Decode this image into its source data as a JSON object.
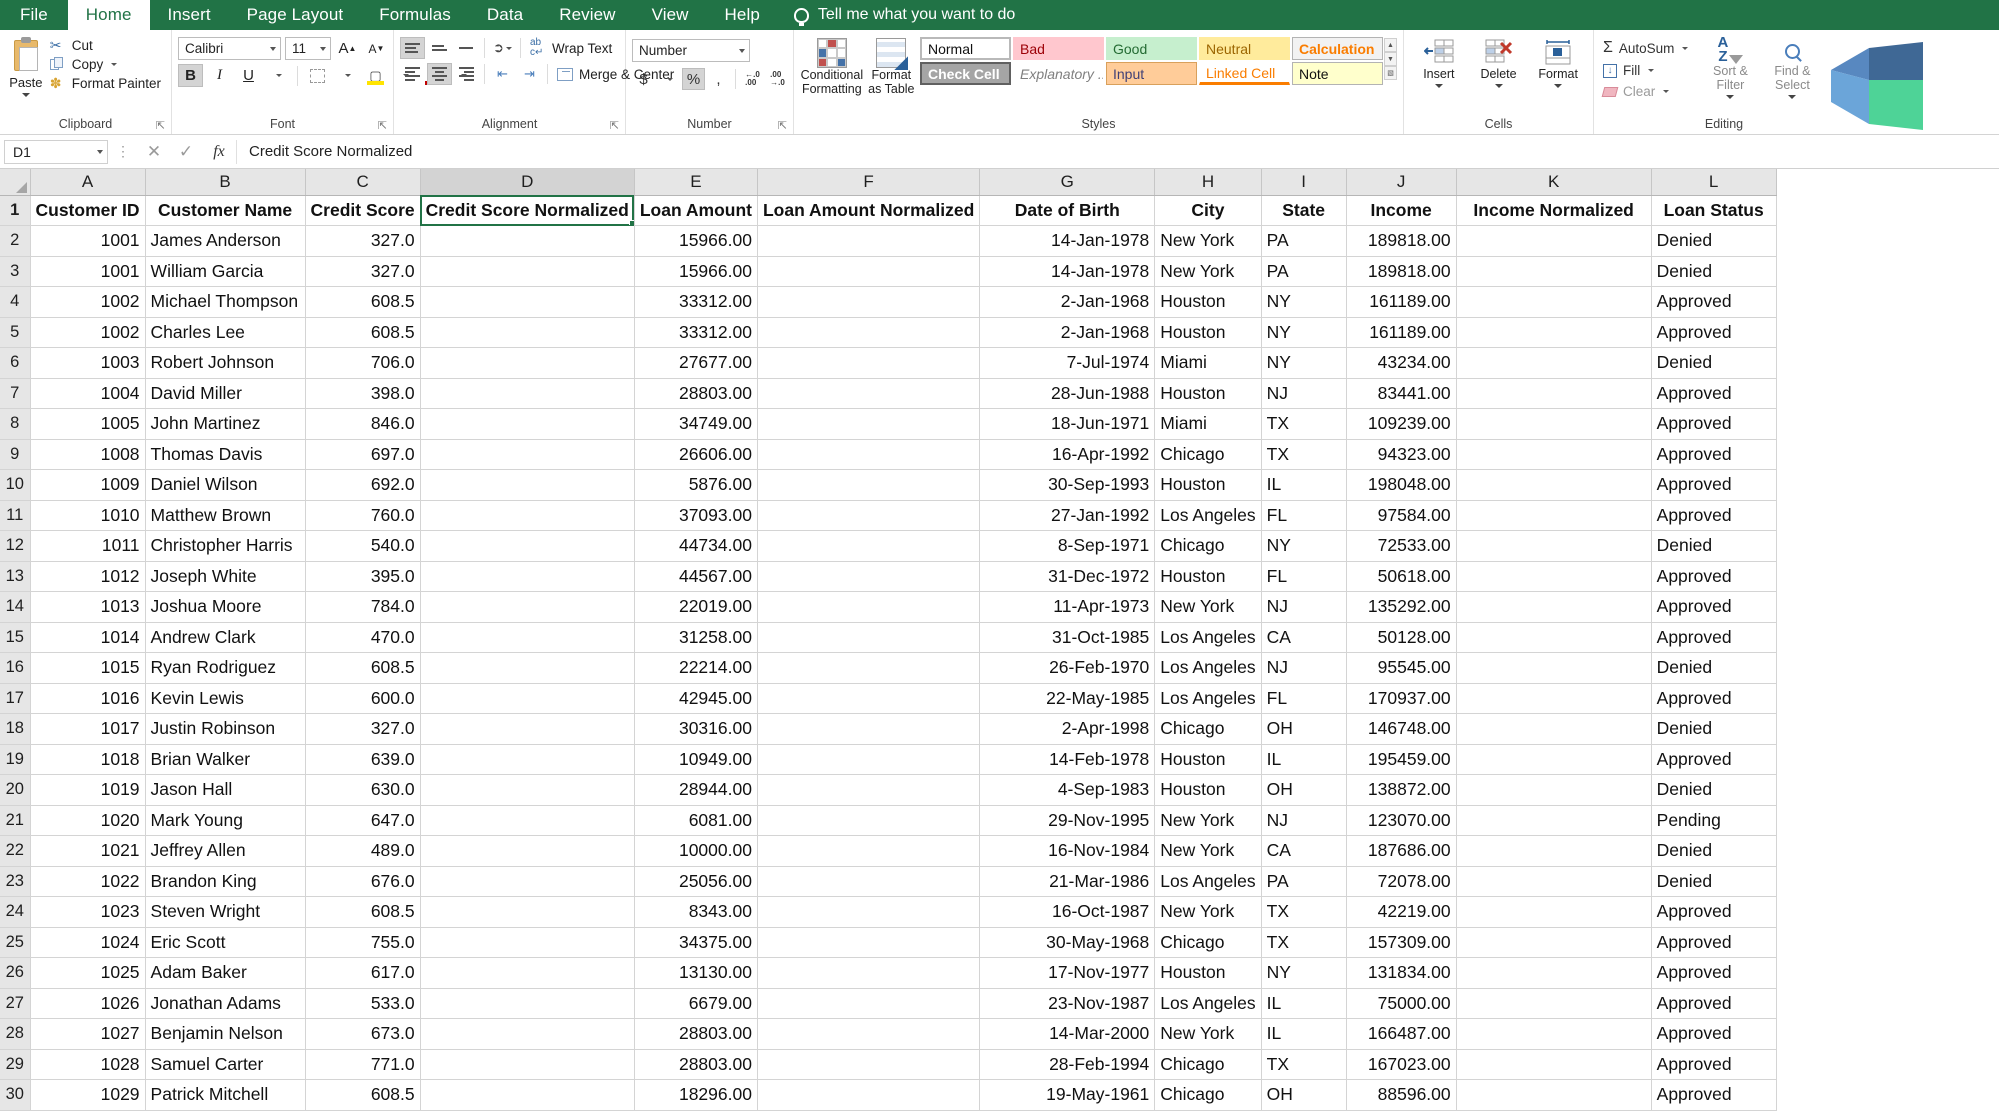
{
  "ribbon": {
    "tabs": [
      {
        "label": "File",
        "active": false
      },
      {
        "label": "Home",
        "active": true
      },
      {
        "label": "Insert",
        "active": false
      },
      {
        "label": "Page Layout",
        "active": false
      },
      {
        "label": "Formulas",
        "active": false
      },
      {
        "label": "Data",
        "active": false
      },
      {
        "label": "Review",
        "active": false
      },
      {
        "label": "View",
        "active": false
      },
      {
        "label": "Help",
        "active": false
      }
    ],
    "tellme": "Tell me what you want to do",
    "clipboard": {
      "group_label": "Clipboard",
      "paste_label": "Paste",
      "cut_label": "Cut",
      "copy_label": "Copy",
      "format_painter_label": "Format Painter"
    },
    "font": {
      "group_label": "Font",
      "font_name": "Calibri",
      "font_size": "11",
      "bold_label": "B",
      "italic_label": "I",
      "underline_label": "U",
      "grow_label": "A",
      "shrink_label": "A"
    },
    "alignment": {
      "group_label": "Alignment",
      "wrap_text_label": "Wrap Text",
      "merge_center_label": "Merge & Center"
    },
    "number": {
      "group_label": "Number",
      "format": "Number",
      "currency_label": "$",
      "percent_label": "%",
      "comma_label": ",",
      "decrease_decimal_label": ".00",
      "increase_decimal_label": ".00"
    },
    "styles": {
      "group_label": "Styles",
      "conditional_formatting_label": "Conditional Formatting",
      "format_as_table_label": "Format as Table",
      "gallery": [
        {
          "label": "Normal",
          "cls": "s-normal"
        },
        {
          "label": "Bad",
          "cls": "s-bad"
        },
        {
          "label": "Good",
          "cls": "s-good"
        },
        {
          "label": "Neutral",
          "cls": "s-neutral"
        },
        {
          "label": "Calculation",
          "cls": "s-calc"
        },
        {
          "label": "Check Cell",
          "cls": "s-check"
        },
        {
          "label": "Explanatory ...",
          "cls": "s-expl"
        },
        {
          "label": "Input",
          "cls": "s-input"
        },
        {
          "label": "Linked Cell",
          "cls": "s-linked"
        },
        {
          "label": "Note",
          "cls": "s-note"
        }
      ]
    },
    "cells": {
      "group_label": "Cells",
      "insert_label": "Insert",
      "delete_label": "Delete",
      "format_label": "Format"
    },
    "editing": {
      "group_label": "Editing",
      "autosum_label": "AutoSum",
      "fill_label": "Fill",
      "clear_label": "Clear",
      "sort_filter_label": "Sort & Filter",
      "find_select_label": "Find & Select"
    }
  },
  "formula_bar": {
    "name_box": "D1",
    "cancel_icon": "✕",
    "confirm_icon": "✓",
    "fx_label": "fx",
    "value": "Credit Score Normalized"
  },
  "sheet": {
    "columns": [
      "A",
      "B",
      "C",
      "D",
      "E",
      "F",
      "G",
      "H",
      "I",
      "J",
      "K",
      "L"
    ],
    "selected_column": "D",
    "selected_cell": "D1",
    "headers": [
      "Customer ID",
      "Customer Name",
      "Credit Score",
      "Credit Score Normalized",
      "Loan Amount",
      "Loan Amount Normalized",
      "Date of Birth",
      "City",
      "State",
      "Income",
      "Income Normalized",
      "Loan Status"
    ],
    "rows": [
      {
        "n": "2",
        "a": "1001",
        "b": "James Anderson",
        "c": "327.0",
        "d": "",
        "e": "15966.00",
        "f": "",
        "g": "14-Jan-1978",
        "h": "New York",
        "i": "PA",
        "j": "189818.00",
        "k": "",
        "l": "Denied"
      },
      {
        "n": "3",
        "a": "1001",
        "b": "William Garcia",
        "c": "327.0",
        "d": "",
        "e": "15966.00",
        "f": "",
        "g": "14-Jan-1978",
        "h": "New York",
        "i": "PA",
        "j": "189818.00",
        "k": "",
        "l": "Denied"
      },
      {
        "n": "4",
        "a": "1002",
        "b": "Michael Thompson",
        "c": "608.5",
        "d": "",
        "e": "33312.00",
        "f": "",
        "g": "2-Jan-1968",
        "h": "Houston",
        "i": "NY",
        "j": "161189.00",
        "k": "",
        "l": "Approved"
      },
      {
        "n": "5",
        "a": "1002",
        "b": "Charles Lee",
        "c": "608.5",
        "d": "",
        "e": "33312.00",
        "f": "",
        "g": "2-Jan-1968",
        "h": "Houston",
        "i": "NY",
        "j": "161189.00",
        "k": "",
        "l": "Approved"
      },
      {
        "n": "6",
        "a": "1003",
        "b": "Robert Johnson",
        "c": "706.0",
        "d": "",
        "e": "27677.00",
        "f": "",
        "g": "7-Jul-1974",
        "h": "Miami",
        "i": "NY",
        "j": "43234.00",
        "k": "",
        "l": "Denied"
      },
      {
        "n": "7",
        "a": "1004",
        "b": "David Miller",
        "c": "398.0",
        "d": "",
        "e": "28803.00",
        "f": "",
        "g": "28-Jun-1988",
        "h": "Houston",
        "i": "NJ",
        "j": "83441.00",
        "k": "",
        "l": "Approved"
      },
      {
        "n": "8",
        "a": "1005",
        "b": "John Martinez",
        "c": "846.0",
        "d": "",
        "e": "34749.00",
        "f": "",
        "g": "18-Jun-1971",
        "h": "Miami",
        "i": "TX",
        "j": "109239.00",
        "k": "",
        "l": "Approved"
      },
      {
        "n": "9",
        "a": "1008",
        "b": "Thomas Davis",
        "c": "697.0",
        "d": "",
        "e": "26606.00",
        "f": "",
        "g": "16-Apr-1992",
        "h": "Chicago",
        "i": "TX",
        "j": "94323.00",
        "k": "",
        "l": "Approved"
      },
      {
        "n": "10",
        "a": "1009",
        "b": "Daniel Wilson",
        "c": "692.0",
        "d": "",
        "e": "5876.00",
        "f": "",
        "g": "30-Sep-1993",
        "h": "Houston",
        "i": "IL",
        "j": "198048.00",
        "k": "",
        "l": "Approved"
      },
      {
        "n": "11",
        "a": "1010",
        "b": "Matthew Brown",
        "c": "760.0",
        "d": "",
        "e": "37093.00",
        "f": "",
        "g": "27-Jan-1992",
        "h": "Los Angeles",
        "i": "FL",
        "j": "97584.00",
        "k": "",
        "l": "Approved"
      },
      {
        "n": "12",
        "a": "1011",
        "b": "Christopher Harris",
        "c": "540.0",
        "d": "",
        "e": "44734.00",
        "f": "",
        "g": "8-Sep-1971",
        "h": "Chicago",
        "i": "NY",
        "j": "72533.00",
        "k": "",
        "l": "Denied"
      },
      {
        "n": "13",
        "a": "1012",
        "b": "Joseph White",
        "c": "395.0",
        "d": "",
        "e": "44567.00",
        "f": "",
        "g": "31-Dec-1972",
        "h": "Houston",
        "i": "FL",
        "j": "50618.00",
        "k": "",
        "l": "Approved"
      },
      {
        "n": "14",
        "a": "1013",
        "b": "Joshua Moore",
        "c": "784.0",
        "d": "",
        "e": "22019.00",
        "f": "",
        "g": "11-Apr-1973",
        "h": "New York",
        "i": "NJ",
        "j": "135292.00",
        "k": "",
        "l": "Approved"
      },
      {
        "n": "15",
        "a": "1014",
        "b": "Andrew Clark",
        "c": "470.0",
        "d": "",
        "e": "31258.00",
        "f": "",
        "g": "31-Oct-1985",
        "h": "Los Angeles",
        "i": "CA",
        "j": "50128.00",
        "k": "",
        "l": "Approved"
      },
      {
        "n": "16",
        "a": "1015",
        "b": "Ryan Rodriguez",
        "c": "608.5",
        "d": "",
        "e": "22214.00",
        "f": "",
        "g": "26-Feb-1970",
        "h": "Los Angeles",
        "i": "NJ",
        "j": "95545.00",
        "k": "",
        "l": "Denied"
      },
      {
        "n": "17",
        "a": "1016",
        "b": "Kevin Lewis",
        "c": "600.0",
        "d": "",
        "e": "42945.00",
        "f": "",
        "g": "22-May-1985",
        "h": "Los Angeles",
        "i": "FL",
        "j": "170937.00",
        "k": "",
        "l": "Approved"
      },
      {
        "n": "18",
        "a": "1017",
        "b": "Justin Robinson",
        "c": "327.0",
        "d": "",
        "e": "30316.00",
        "f": "",
        "g": "2-Apr-1998",
        "h": "Chicago",
        "i": "OH",
        "j": "146748.00",
        "k": "",
        "l": "Denied"
      },
      {
        "n": "19",
        "a": "1018",
        "b": "Brian Walker",
        "c": "639.0",
        "d": "",
        "e": "10949.00",
        "f": "",
        "g": "14-Feb-1978",
        "h": "Houston",
        "i": "IL",
        "j": "195459.00",
        "k": "",
        "l": "Approved"
      },
      {
        "n": "20",
        "a": "1019",
        "b": "Jason Hall",
        "c": "630.0",
        "d": "",
        "e": "28944.00",
        "f": "",
        "g": "4-Sep-1983",
        "h": "Houston",
        "i": "OH",
        "j": "138872.00",
        "k": "",
        "l": "Denied"
      },
      {
        "n": "21",
        "a": "1020",
        "b": "Mark Young",
        "c": "647.0",
        "d": "",
        "e": "6081.00",
        "f": "",
        "g": "29-Nov-1995",
        "h": "New York",
        "i": "NJ",
        "j": "123070.00",
        "k": "",
        "l": "Pending"
      },
      {
        "n": "22",
        "a": "1021",
        "b": "Jeffrey Allen",
        "c": "489.0",
        "d": "",
        "e": "10000.00",
        "f": "",
        "g": "16-Nov-1984",
        "h": "New York",
        "i": "CA",
        "j": "187686.00",
        "k": "",
        "l": "Denied"
      },
      {
        "n": "23",
        "a": "1022",
        "b": "Brandon King",
        "c": "676.0",
        "d": "",
        "e": "25056.00",
        "f": "",
        "g": "21-Mar-1986",
        "h": "Los Angeles",
        "i": "PA",
        "j": "72078.00",
        "k": "",
        "l": "Denied"
      },
      {
        "n": "24",
        "a": "1023",
        "b": "Steven Wright",
        "c": "608.5",
        "d": "",
        "e": "8343.00",
        "f": "",
        "g": "16-Oct-1987",
        "h": "New York",
        "i": "TX",
        "j": "42219.00",
        "k": "",
        "l": "Approved"
      },
      {
        "n": "25",
        "a": "1024",
        "b": "Eric Scott",
        "c": "755.0",
        "d": "",
        "e": "34375.00",
        "f": "",
        "g": "30-May-1968",
        "h": "Chicago",
        "i": "TX",
        "j": "157309.00",
        "k": "",
        "l": "Approved"
      },
      {
        "n": "26",
        "a": "1025",
        "b": "Adam Baker",
        "c": "617.0",
        "d": "",
        "e": "13130.00",
        "f": "",
        "g": "17-Nov-1977",
        "h": "Houston",
        "i": "NY",
        "j": "131834.00",
        "k": "",
        "l": "Approved"
      },
      {
        "n": "27",
        "a": "1026",
        "b": "Jonathan Adams",
        "c": "533.0",
        "d": "",
        "e": "6679.00",
        "f": "",
        "g": "23-Nov-1987",
        "h": "Los Angeles",
        "i": "IL",
        "j": "75000.00",
        "k": "",
        "l": "Approved"
      },
      {
        "n": "28",
        "a": "1027",
        "b": "Benjamin Nelson",
        "c": "673.0",
        "d": "",
        "e": "28803.00",
        "f": "",
        "g": "14-Mar-2000",
        "h": "New York",
        "i": "IL",
        "j": "166487.00",
        "k": "",
        "l": "Approved"
      },
      {
        "n": "29",
        "a": "1028",
        "b": "Samuel Carter",
        "c": "771.0",
        "d": "",
        "e": "28803.00",
        "f": "",
        "g": "28-Feb-1994",
        "h": "Chicago",
        "i": "TX",
        "j": "167023.00",
        "k": "",
        "l": "Approved"
      },
      {
        "n": "30",
        "a": "1029",
        "b": "Patrick Mitchell",
        "c": "608.5",
        "d": "",
        "e": "18296.00",
        "f": "",
        "g": "19-May-1961",
        "h": "Chicago",
        "i": "OH",
        "j": "88596.00",
        "k": "",
        "l": "Approved"
      }
    ]
  }
}
